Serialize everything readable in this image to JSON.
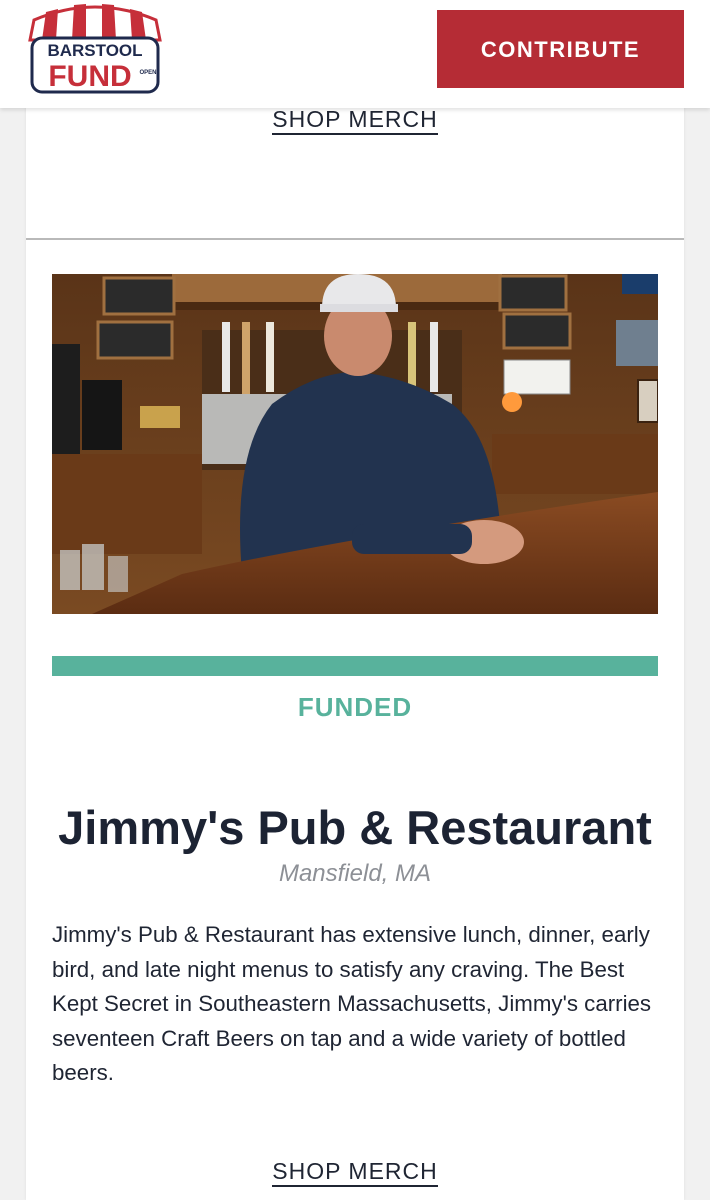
{
  "header": {
    "logo": {
      "text_top": "BARSTOOL",
      "text_bottom": "FUND",
      "tag": "OPEN",
      "colors": {
        "red": "#c62f3a",
        "navy": "#1f2a4d"
      }
    },
    "contribute_label": "CONTRIBUTE"
  },
  "colors": {
    "accent_red": "#b52c35",
    "funded_green": "#58b29c",
    "text_dark": "#1c2333",
    "text_muted": "#8d9096"
  },
  "previous_card": {
    "shop_label": "SHOP MERCH"
  },
  "card": {
    "image_alt": "man in cap leaning on pub bar",
    "progress_fraction": 1.0,
    "status": "FUNDED",
    "title": "Jimmy's Pub & Restaurant",
    "location": "Mansfield, MA",
    "description": "Jimmy's Pub & Restaurant has extensive lunch, dinner, early bird, and late night menus to satisfy any craving. The Best Kept Secret in Southeastern Massachusetts, Jimmy's carries seventeen Craft Beers on tap and a wide variety of bottled beers.",
    "shop_label": "SHOP MERCH"
  }
}
